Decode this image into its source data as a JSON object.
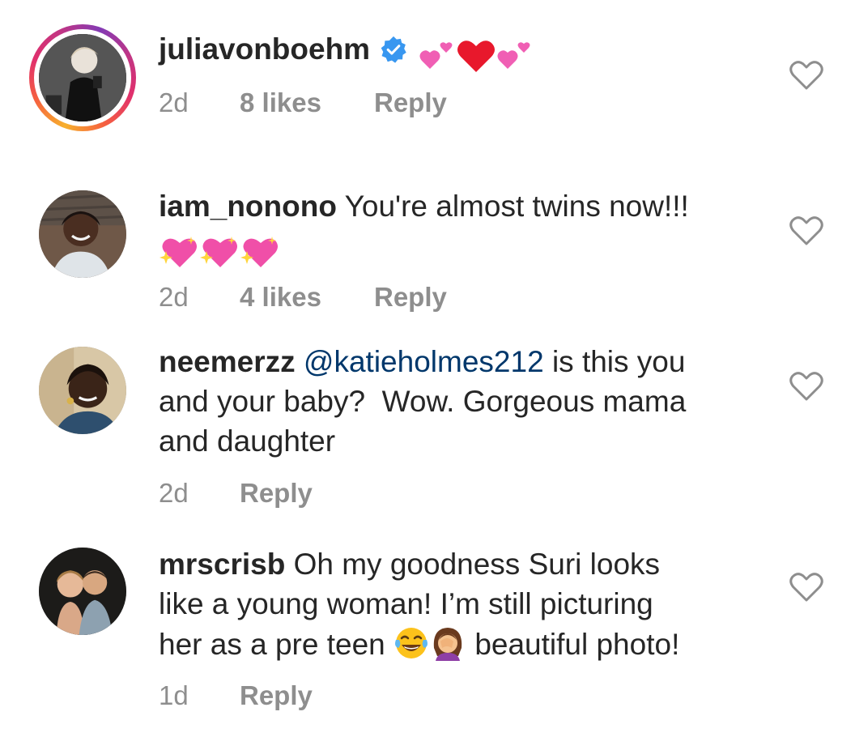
{
  "comments": [
    {
      "username": "juliavonboehm",
      "verified": true,
      "text": "",
      "emoji": [
        "two-hearts-icon",
        "red-heart-icon",
        "two-hearts-icon"
      ],
      "time": "2d",
      "likes": "8 likes",
      "reply": "Reply",
      "has_story": true
    },
    {
      "username": "iam_nonono",
      "text": "You're almost twins now!!!",
      "emoji": [
        "sparkling-heart-icon",
        "sparkling-heart-icon",
        "sparkling-heart-icon"
      ],
      "time": "2d",
      "likes": "4 likes",
      "reply": "Reply"
    },
    {
      "username": "neemerzz",
      "mention": "@katieholmes212",
      "text_line1": "is this you",
      "text_line2": "and your baby?  Wow. Gorgeous mama",
      "text_line3": "and daughter",
      "time": "2d",
      "reply": "Reply"
    },
    {
      "username": "mrscrisb",
      "text_line1": "Oh my goodness Suri looks",
      "text_line2": "like a young woman! I’m still picturing",
      "text_line3_a": "her as a pre teen",
      "text_line3_b": "beautiful photo!",
      "emoji": [
        "face-with-tears-of-joy-icon",
        "woman-facepalming-icon"
      ],
      "time": "1d",
      "reply": "Reply"
    }
  ],
  "colors": {
    "text": "#262626",
    "meta": "#8e8e8e",
    "mention": "#00376b",
    "verified": "#3897f0"
  }
}
